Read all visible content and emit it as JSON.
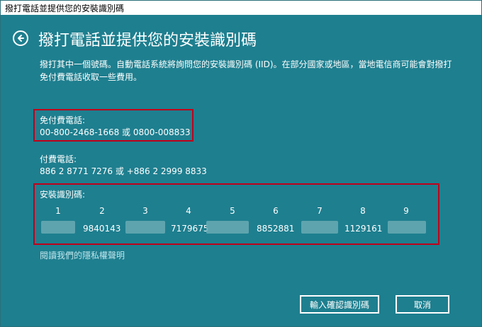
{
  "window": {
    "title": "撥打電話並提供您的安裝識別碼"
  },
  "page": {
    "heading": "撥打電話並提供您的安裝識別碼",
    "description": "撥打其中一個號碼。自動電話系統將詢問您的安裝識別碼 (IID)。在部分國家或地區，當地電信商可能會對撥打免付費電話收取一些費用。"
  },
  "toll_free": {
    "label": "免付費電話:",
    "numbers": "00-800-2468-1668 或 0800-008833"
  },
  "toll": {
    "label": "付費電話:",
    "numbers": "886 2 8771 7276 或 +886 2 2999 8833"
  },
  "installation_id": {
    "label": "安裝識別碼:",
    "groups": [
      {
        "number": "1",
        "value": ""
      },
      {
        "number": "2",
        "value": "9840143"
      },
      {
        "number": "3",
        "value": ""
      },
      {
        "number": "4",
        "value": "7179675"
      },
      {
        "number": "5",
        "value": ""
      },
      {
        "number": "6",
        "value": "8852881"
      },
      {
        "number": "7",
        "value": ""
      },
      {
        "number": "8",
        "value": "1129161"
      },
      {
        "number": "9",
        "value": ""
      }
    ]
  },
  "privacy_link": "閱讀我們的隱私權聲明",
  "buttons": {
    "confirm": "輸入確認識別碼",
    "cancel": "取消"
  },
  "icons": {
    "back": "back-arrow-icon"
  },
  "colors": {
    "background": "#1e7f8f",
    "highlight": "#c0001a",
    "text": "#ffffff"
  }
}
